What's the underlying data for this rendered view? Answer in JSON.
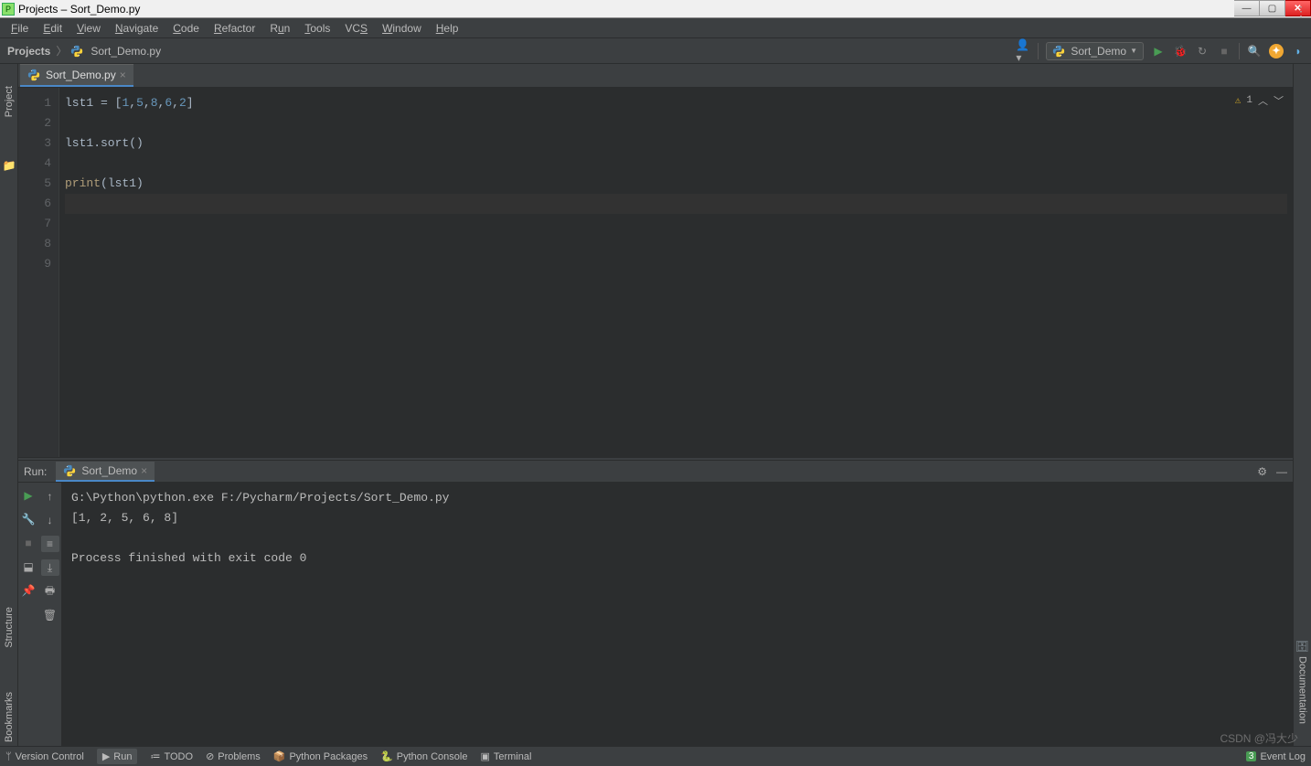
{
  "window": {
    "title": "Projects – Sort_Demo.py"
  },
  "menu": [
    "File",
    "Edit",
    "View",
    "Navigate",
    "Code",
    "Refactor",
    "Run",
    "Tools",
    "VCS",
    "Window",
    "Help"
  ],
  "breadcrumb": {
    "root": "Projects",
    "file": "Sort_Demo.py"
  },
  "run_config": {
    "name": "Sort_Demo"
  },
  "editor": {
    "tab": "Sort_Demo.py",
    "lines": [
      "1",
      "2",
      "3",
      "4",
      "5",
      "6",
      "7",
      "8",
      "9"
    ],
    "code": {
      "l1_var": "lst1",
      "l1_eq": " = [",
      "l1_n1": "1",
      "l1_c1": ",",
      "l1_n2": "5",
      "l1_c2": ",",
      "l1_n3": "8",
      "l1_c3": ",",
      "l1_n4": "6",
      "l1_c4": ",",
      "l1_n5": "2",
      "l1_close": "]",
      "l3": "lst1.sort()",
      "l5_fn": "print",
      "l5_args": "(lst1)"
    },
    "inspection": {
      "count": "1"
    }
  },
  "run_panel": {
    "label": "Run:",
    "tab": "Sort_Demo",
    "output": [
      "G:\\Python\\python.exe F:/Pycharm/Projects/Sort_Demo.py",
      "[1, 2, 5, 6, 8]",
      "",
      "Process finished with exit code 0"
    ]
  },
  "left_tabs": {
    "project": "Project",
    "structure": "Structure",
    "bookmarks": "Bookmarks"
  },
  "right_tabs": {
    "doc": "Documentation"
  },
  "statusbar": {
    "items": [
      "Version Control",
      "Run",
      "TODO",
      "Problems",
      "Python Packages",
      "Python Console",
      "Terminal"
    ],
    "event_log": "Event Log",
    "event_count": "3"
  },
  "watermark": "CSDN @冯大少"
}
